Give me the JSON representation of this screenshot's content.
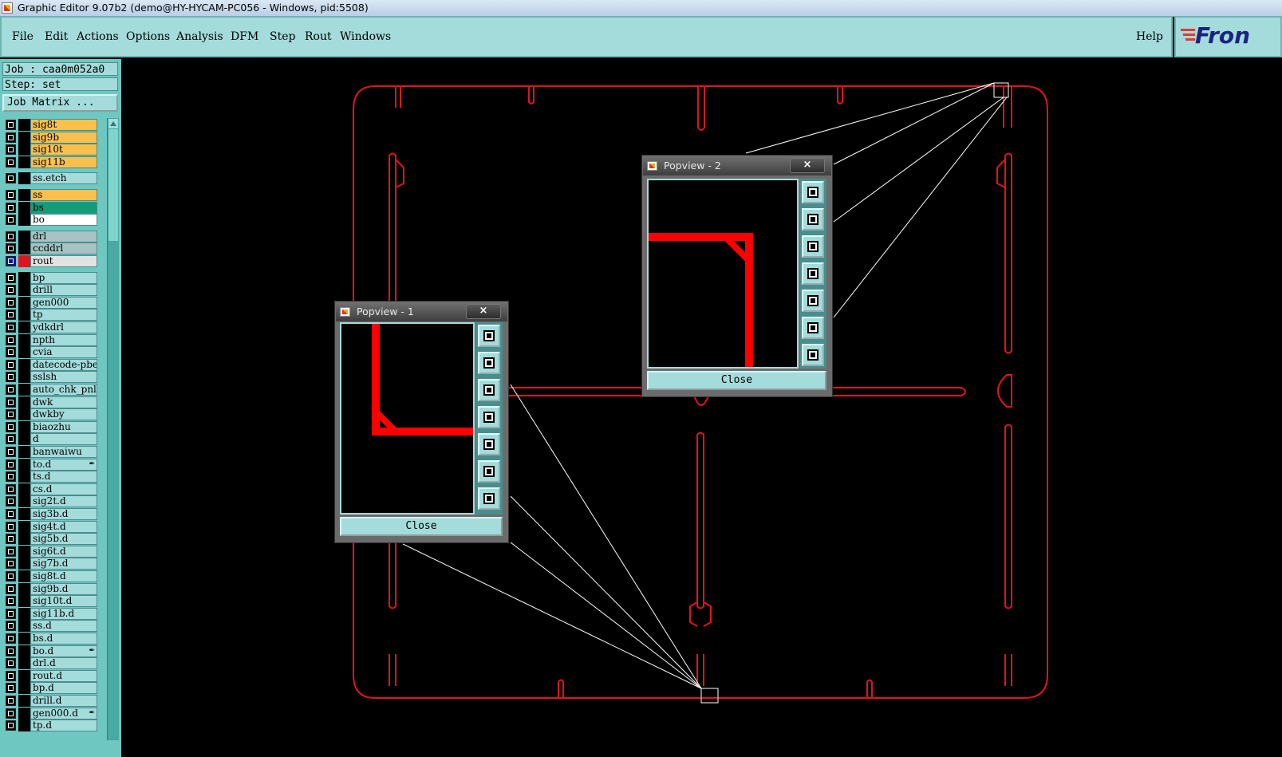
{
  "window": {
    "title": "Graphic Editor 9.07b2 (demo@HY-HYCAM-PC056 - Windows, pid:5508)"
  },
  "menu": {
    "items": [
      "File",
      "Edit",
      "Actions",
      "Options",
      "Analysis",
      "DFM",
      "Step",
      "Rout",
      "Windows"
    ],
    "help": "Help"
  },
  "logo": {
    "text": "Fron"
  },
  "job": {
    "job_label": "Job : caa0m052a0",
    "step_label": "Step: set",
    "matrix_button": "Job Matrix ..."
  },
  "layers": [
    {
      "name": "sig8t",
      "color": "#f9c04d"
    },
    {
      "name": "sig9b",
      "color": "#f9c04d"
    },
    {
      "name": "sig10t",
      "color": "#f9c04d"
    },
    {
      "name": "sig11b",
      "color": "#f9c04d"
    },
    {
      "name": "ss.etch",
      "color": "#a4dbdb"
    },
    {
      "name": "ss",
      "color": "#f9c04d"
    },
    {
      "name": "bs",
      "color": "#129c77"
    },
    {
      "name": "bo",
      "color": "#ffffff"
    },
    {
      "name": "drl",
      "color": "#a7c3c3"
    },
    {
      "name": "ccddrl",
      "color": "#a7c3c3"
    },
    {
      "name": "rout",
      "color": "#e2e2e2",
      "active": true
    },
    {
      "name": "bp",
      "color": "#a4dbdb"
    },
    {
      "name": "drill",
      "color": "#a4dbdb"
    },
    {
      "name": "gen000",
      "color": "#a4dbdb"
    },
    {
      "name": "tp",
      "color": "#a4dbdb"
    },
    {
      "name": "ydkdrl",
      "color": "#a4dbdb"
    },
    {
      "name": "npth",
      "color": "#a4dbdb"
    },
    {
      "name": "cvia",
      "color": "#a4dbdb"
    },
    {
      "name": "datecode-pbe",
      "color": "#a4dbdb"
    },
    {
      "name": "sslsh",
      "color": "#a4dbdb"
    },
    {
      "name": "auto_chk_pnl",
      "color": "#a4dbdb"
    },
    {
      "name": "dwk",
      "color": "#a4dbdb"
    },
    {
      "name": "dwkby",
      "color": "#a4dbdb"
    },
    {
      "name": "biaozhu",
      "color": "#a4dbdb"
    },
    {
      "name": "d",
      "color": "#a4dbdb"
    },
    {
      "name": "banwaiwu",
      "color": "#a4dbdb"
    },
    {
      "name": "to.d",
      "color": "#a4dbdb",
      "flag": true
    },
    {
      "name": "ts.d",
      "color": "#a4dbdb"
    },
    {
      "name": "cs.d",
      "color": "#a4dbdb"
    },
    {
      "name": "sig2t.d",
      "color": "#a4dbdb"
    },
    {
      "name": "sig3b.d",
      "color": "#a4dbdb"
    },
    {
      "name": "sig4t.d",
      "color": "#a4dbdb"
    },
    {
      "name": "sig5b.d",
      "color": "#a4dbdb"
    },
    {
      "name": "sig6t.d",
      "color": "#a4dbdb"
    },
    {
      "name": "sig7b.d",
      "color": "#a4dbdb"
    },
    {
      "name": "sig8t.d",
      "color": "#a4dbdb"
    },
    {
      "name": "sig9b.d",
      "color": "#a4dbdb"
    },
    {
      "name": "sig10t.d",
      "color": "#a4dbdb"
    },
    {
      "name": "sig11b.d",
      "color": "#a4dbdb"
    },
    {
      "name": "ss.d",
      "color": "#a4dbdb"
    },
    {
      "name": "bs.d",
      "color": "#a4dbdb"
    },
    {
      "name": "bo.d",
      "color": "#a4dbdb",
      "flag": true
    },
    {
      "name": "drl.d",
      "color": "#a4dbdb"
    },
    {
      "name": "rout.d",
      "color": "#a4dbdb"
    },
    {
      "name": "bp.d",
      "color": "#a4dbdb"
    },
    {
      "name": "drill.d",
      "color": "#a4dbdb"
    },
    {
      "name": "gen000.d",
      "color": "#a4dbdb",
      "flag": true
    },
    {
      "name": "tp.d",
      "color": "#a4dbdb"
    }
  ],
  "popviews": [
    {
      "title": "Popview - 1",
      "close_label": "Close",
      "close_x": "×"
    },
    {
      "title": "Popview - 2",
      "close_label": "Close",
      "close_x": "×"
    }
  ],
  "colors": {
    "rout_line": "#e0141e",
    "background": "#000000",
    "panel": "#a4dbdb"
  }
}
